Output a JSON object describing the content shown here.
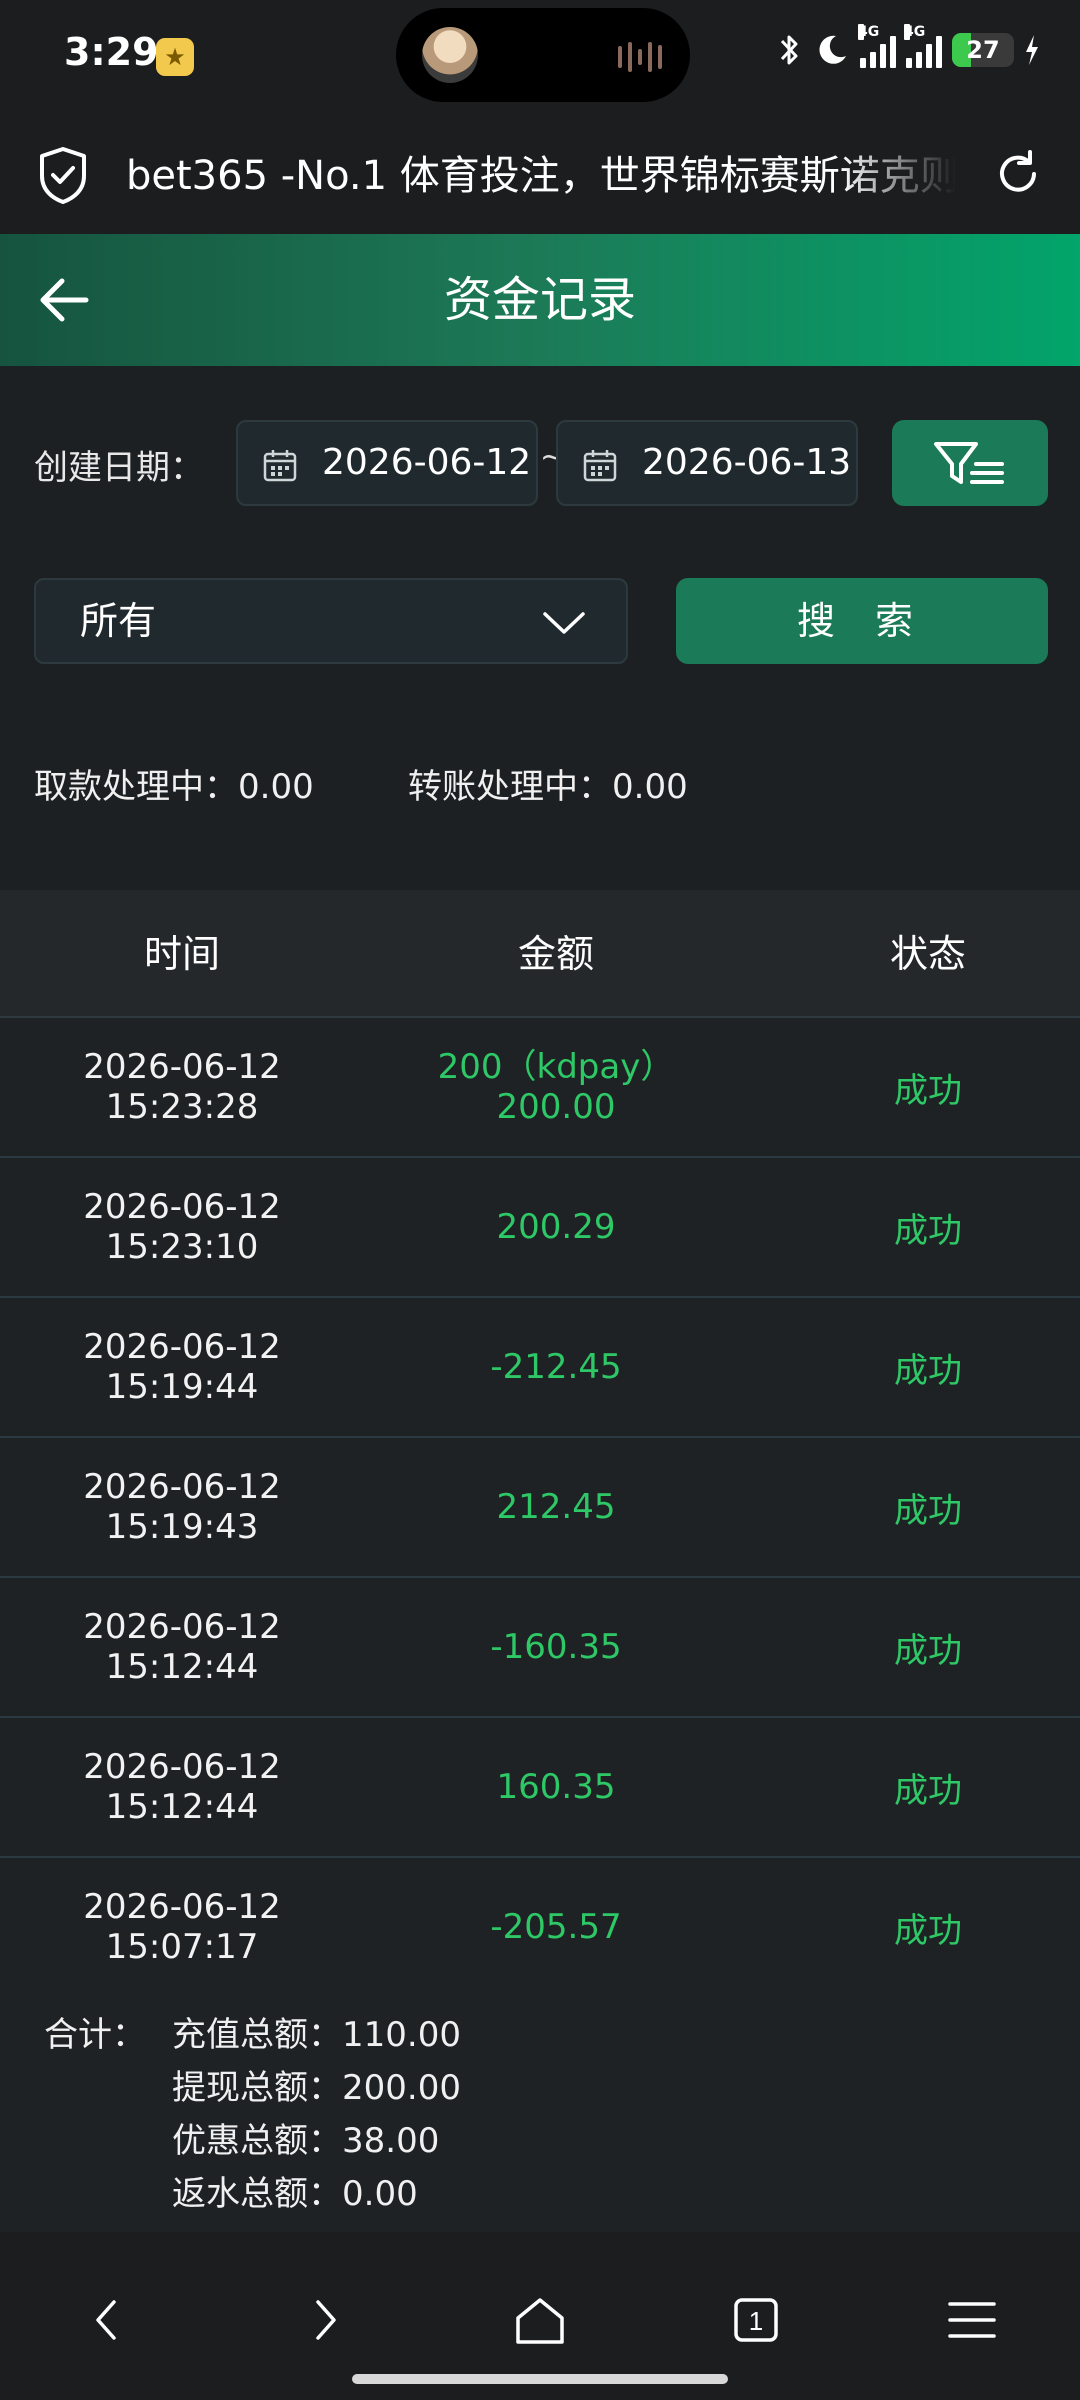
{
  "status_bar": {
    "time": "3:29",
    "battery": "27",
    "network1": "4G",
    "network2": "4G"
  },
  "browser": {
    "url_title": "bet365 -No.1 体育投注，世界锦标赛斯诺克则"
  },
  "header": {
    "title": "资金记录"
  },
  "filters": {
    "date_label": "创建日期：",
    "start_date": "2026-06-12",
    "separator": "~",
    "end_date": "2026-06-13",
    "type_select": "所有",
    "search_label": "搜 索"
  },
  "processing": {
    "withdraw_label": "取款处理中：",
    "withdraw_value": "0.00",
    "transfer_label": "转账处理中：",
    "transfer_value": "0.00"
  },
  "table": {
    "columns": [
      "时间",
      "金额",
      "状态"
    ],
    "rows": [
      {
        "date": "2026-06-12",
        "time": "15:23:28",
        "amount_line1": "200（kdpay）",
        "amount": "200.00",
        "status": "成功"
      },
      {
        "date": "2026-06-12",
        "time": "15:23:10",
        "amount_line1": "",
        "amount": "200.29",
        "status": "成功"
      },
      {
        "date": "2026-06-12",
        "time": "15:19:44",
        "amount_line1": "",
        "amount": "-212.45",
        "status": "成功"
      },
      {
        "date": "2026-06-12",
        "time": "15:19:43",
        "amount_line1": "",
        "amount": "212.45",
        "status": "成功"
      },
      {
        "date": "2026-06-12",
        "time": "15:12:44",
        "amount_line1": "",
        "amount": "-160.35",
        "status": "成功"
      },
      {
        "date": "2026-06-12",
        "time": "15:12:44",
        "amount_line1": "",
        "amount": "160.35",
        "status": "成功"
      },
      {
        "date": "2026-06-12",
        "time": "15:07:17",
        "amount_line1": "",
        "amount": "-205.57",
        "status": "成功"
      }
    ]
  },
  "summary": {
    "label": "合计：",
    "deposit": "充值总额：110.00",
    "withdraw": "提现总额：200.00",
    "bonus": "优惠总额：38.00",
    "rebate": "返水总额：0.00"
  },
  "nav_bar": {
    "tab_count": "1"
  },
  "colors": {
    "accent_green": "#1b7a58",
    "amount_green": "#2ec867",
    "background": "#1d2022"
  }
}
